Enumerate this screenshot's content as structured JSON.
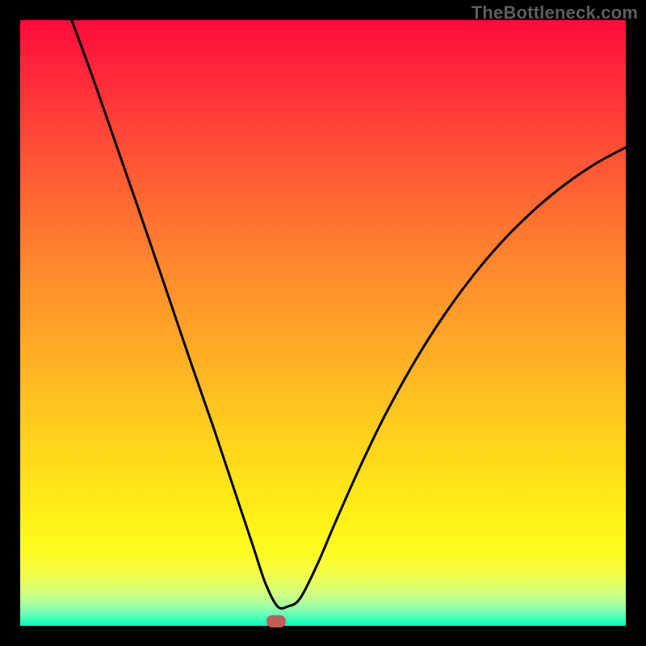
{
  "watermark": "TheBottleneck.com",
  "marker": {
    "x_frac": 0.423,
    "y_frac": 0.993
  },
  "colors": {
    "frame": "#000000",
    "curve": "#000000",
    "marker": "#c65a56",
    "watermark": "#5d5d5d"
  },
  "chart_data": {
    "type": "line",
    "title": "",
    "xlabel": "",
    "ylabel": "",
    "xlim": [
      0,
      1
    ],
    "ylim": [
      0,
      1
    ],
    "series": [
      {
        "name": "bottleneck-curve",
        "x": [
          0.085,
          0.12,
          0.16,
          0.2,
          0.24,
          0.28,
          0.32,
          0.355,
          0.385,
          0.405,
          0.425,
          0.442,
          0.462,
          0.49,
          0.52,
          0.56,
          0.6,
          0.65,
          0.7,
          0.75,
          0.8,
          0.85,
          0.9,
          0.95,
          1.0
        ],
        "y": [
          1.0,
          0.905,
          0.79,
          0.675,
          0.558,
          0.44,
          0.325,
          0.22,
          0.13,
          0.07,
          0.032,
          0.032,
          0.045,
          0.1,
          0.17,
          0.26,
          0.343,
          0.434,
          0.513,
          0.581,
          0.639,
          0.688,
          0.729,
          0.763,
          0.79
        ]
      }
    ],
    "annotations": [
      {
        "type": "marker",
        "x": 0.423,
        "y": 0.007
      }
    ]
  }
}
